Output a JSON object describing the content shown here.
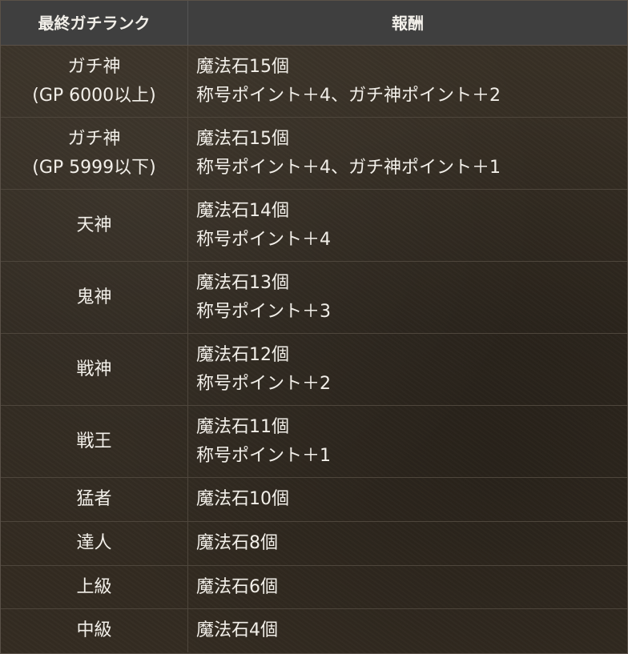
{
  "header": {
    "rank": "最終ガチランク",
    "reward": "報酬"
  },
  "rows": [
    {
      "rank": [
        "ガチ神",
        "(GP 6000以上)"
      ],
      "reward": [
        "魔法石15個",
        "称号ポイント＋4、ガチ神ポイント＋2"
      ]
    },
    {
      "rank": [
        "ガチ神",
        "(GP 5999以下)"
      ],
      "reward": [
        "魔法石15個",
        "称号ポイント＋4、ガチ神ポイント＋1"
      ]
    },
    {
      "rank": [
        "天神"
      ],
      "reward": [
        "魔法石14個",
        "称号ポイント＋4"
      ]
    },
    {
      "rank": [
        "鬼神"
      ],
      "reward": [
        "魔法石13個",
        "称号ポイント＋3"
      ]
    },
    {
      "rank": [
        "戦神"
      ],
      "reward": [
        "魔法石12個",
        "称号ポイント＋2"
      ]
    },
    {
      "rank": [
        "戦王"
      ],
      "reward": [
        "魔法石11個",
        "称号ポイント＋1"
      ]
    },
    {
      "rank": [
        "猛者"
      ],
      "reward": [
        "魔法石10個"
      ]
    },
    {
      "rank": [
        "達人"
      ],
      "reward": [
        "魔法石8個"
      ]
    },
    {
      "rank": [
        "上級"
      ],
      "reward": [
        "魔法石6個"
      ]
    },
    {
      "rank": [
        "中級"
      ],
      "reward": [
        "魔法石4個"
      ]
    }
  ]
}
